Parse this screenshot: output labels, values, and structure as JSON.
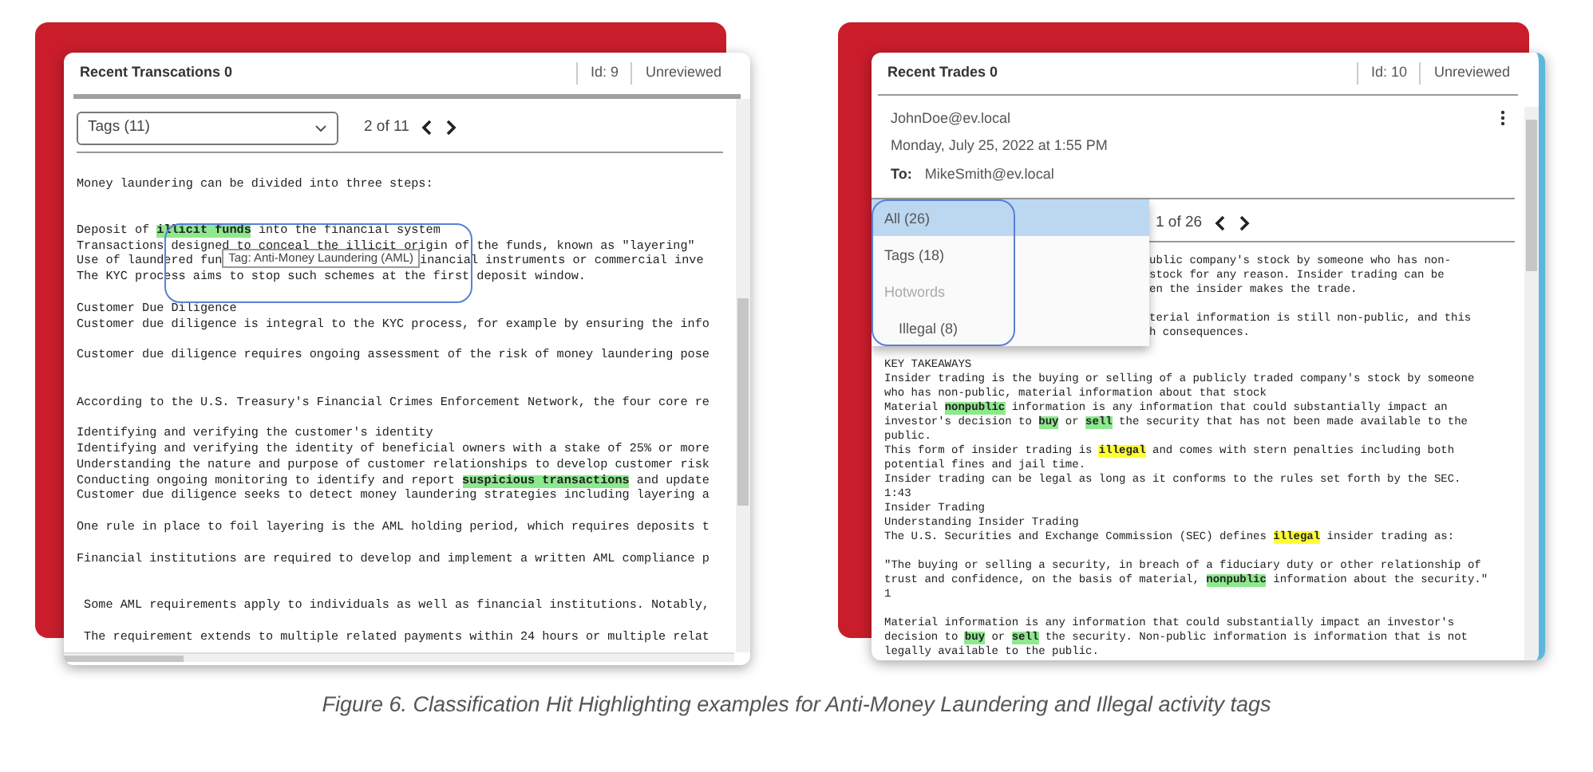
{
  "transaction_panel": {
    "title": "Recent Transcations 0",
    "id": "Id: 9",
    "status": "Unreviewed",
    "tag_select": {
      "value": "Tags (11)"
    },
    "pager": {
      "position": "2 of 11"
    },
    "lines": [
      {
        "kind": "text",
        "text": "Money laundering can be divided into three steps:"
      },
      {
        "kind": "blank"
      },
      {
        "kind": "blank"
      },
      {
        "kind": "marked",
        "segments": [
          {
            "kind": "plain",
            "text": "Deposit of "
          },
          {
            "kind": "hit",
            "text": "illicit funds",
            "color": "#8ee88e"
          },
          {
            "kind": "plain",
            "text": " into the financial system"
          }
        ]
      },
      {
        "kind": "text",
        "text": "Transactions designed to conceal the illicit origin of the funds, known as \"layering\""
      },
      {
        "kind": "marked",
        "segments": [
          {
            "kind": "plain",
            "text": "Use of laundered fun"
          },
          {
            "kind": "tooltip",
            "text": "Tag: Anti-Money Laundering (AML)"
          },
          {
            "kind": "plain",
            "text": "inancial instruments or commercial inve"
          }
        ]
      },
      {
        "kind": "text",
        "text": "The KYC process aims to stop such schemes at the first deposit window."
      },
      {
        "kind": "blank"
      },
      {
        "kind": "text",
        "text": "Customer Due Diligence"
      },
      {
        "kind": "text",
        "text": "Customer due diligence is integral to the KYC process, for example by ensuring the info"
      },
      {
        "kind": "blank"
      },
      {
        "kind": "text",
        "text": "Customer due diligence requires ongoing assessment of the risk of money laundering pose"
      },
      {
        "kind": "blank"
      },
      {
        "kind": "blank"
      },
      {
        "kind": "text",
        "text": "According to the U.S. Treasury's Financial Crimes Enforcement Network, the four core re"
      },
      {
        "kind": "blank"
      },
      {
        "kind": "text",
        "text": "Identifying and verifying the customer's identity"
      },
      {
        "kind": "text",
        "text": "Identifying and verifying the identity of beneficial owners with a stake of 25% or more"
      },
      {
        "kind": "text",
        "text": "Understanding the nature and purpose of customer relationships to develop customer risk"
      },
      {
        "kind": "marked",
        "segments": [
          {
            "kind": "plain",
            "text": "Conducting ongoing monitoring to identify and report "
          },
          {
            "kind": "hit",
            "text": "suspicious transactions",
            "color": "#8ee88e"
          },
          {
            "kind": "plain",
            "text": " and update"
          }
        ]
      },
      {
        "kind": "text",
        "text": "Customer due diligence seeks to detect money laundering strategies including layering a"
      },
      {
        "kind": "blank"
      },
      {
        "kind": "text",
        "text": "One rule in place to foil layering is the AML holding period, which requires deposits t"
      },
      {
        "kind": "blank"
      },
      {
        "kind": "text",
        "text": "Financial institutions are required to develop and implement a written AML compliance p"
      },
      {
        "kind": "blank"
      },
      {
        "kind": "blank"
      },
      {
        "kind": "text",
        "text": " Some AML requirements apply to individuals as well as financial institutions. Notably,"
      },
      {
        "kind": "blank"
      },
      {
        "kind": "text",
        "text": " The requirement extends to multiple related payments within 24 hours or multiple relat"
      }
    ]
  },
  "trade_panel": {
    "title": "Recent Trades 0",
    "id": "Id: 10",
    "status": "Unreviewed",
    "sender": "JohnDoe@ev.local",
    "date": "Monday, July 25, 2022 at 1:55 PM",
    "to_label": "To:",
    "recipient": "MikeSmith@ev.local",
    "filter_menu": {
      "options": [
        {
          "kind": "option",
          "label": "All (26)",
          "selected": true
        },
        {
          "kind": "option",
          "label": "Tags (18)",
          "selected": false
        },
        {
          "kind": "group",
          "label": "Hotwords",
          "children": [
            {
              "kind": "option",
              "label": "Illegal (8)",
              "selected": false
            }
          ]
        }
      ]
    },
    "pager": {
      "position": "1 of 26"
    },
    "partial_lines": [
      {
        "kind": "text",
        "text": "ublic company's stock by someone who has non-"
      },
      {
        "kind": "text",
        "text": "stock for any reason. Insider trading can be"
      },
      {
        "kind": "text",
        "text": "en the insider makes the trade."
      },
      {
        "kind": "blank"
      },
      {
        "kind": "text",
        "text": "terial information is still non-public, and this"
      },
      {
        "kind": "text",
        "text": "h consequences."
      }
    ],
    "lines": [
      {
        "kind": "text",
        "text": "KEY TAKEAWAYS"
      },
      {
        "kind": "text",
        "text": "Insider trading is the buying or selling of a publicly traded company's stock by someone"
      },
      {
        "kind": "text",
        "text": "who has non-public, material information about that stock"
      },
      {
        "kind": "marked",
        "segments": [
          {
            "kind": "plain",
            "text": "Material "
          },
          {
            "kind": "hit",
            "text": "nonpublic",
            "color": "#8ee88e"
          },
          {
            "kind": "plain",
            "text": " information is any information that could substantially impact an"
          }
        ]
      },
      {
        "kind": "marked",
        "segments": [
          {
            "kind": "plain",
            "text": "investor's decision to "
          },
          {
            "kind": "hit",
            "text": "buy",
            "color": "#8ee88e"
          },
          {
            "kind": "plain",
            "text": " or "
          },
          {
            "kind": "hit",
            "text": "sell",
            "color": "#8ee88e"
          },
          {
            "kind": "plain",
            "text": " the security that has not been made available to the"
          }
        ]
      },
      {
        "kind": "text",
        "text": "public."
      },
      {
        "kind": "marked",
        "segments": [
          {
            "kind": "plain",
            "text": "This form of insider trading is "
          },
          {
            "kind": "hit",
            "text": "illegal",
            "color": "#ffff33"
          },
          {
            "kind": "plain",
            "text": " and comes with stern penalties including both"
          }
        ]
      },
      {
        "kind": "text",
        "text": "potential fines and jail time."
      },
      {
        "kind": "text",
        "text": "Insider trading can be legal as long as it conforms to the rules set forth by the SEC."
      },
      {
        "kind": "text",
        "text": "1:43"
      },
      {
        "kind": "text",
        "text": "Insider Trading"
      },
      {
        "kind": "text",
        "text": "Understanding Insider Trading"
      },
      {
        "kind": "marked",
        "segments": [
          {
            "kind": "plain",
            "text": "The U.S. Securities and Exchange Commission (SEC) defines "
          },
          {
            "kind": "hit",
            "text": "illegal",
            "color": "#ffff33"
          },
          {
            "kind": "plain",
            "text": " insider trading as:"
          }
        ]
      },
      {
        "kind": "blank"
      },
      {
        "kind": "text",
        "text": "\"The buying or selling a security, in breach of a fiduciary duty or other relationship of"
      },
      {
        "kind": "marked",
        "segments": [
          {
            "kind": "plain",
            "text": "trust and confidence, on the basis of material, "
          },
          {
            "kind": "hit",
            "text": "nonpublic",
            "color": "#8ee88e"
          },
          {
            "kind": "plain",
            "text": " information about the security.\""
          }
        ]
      },
      {
        "kind": "text",
        "text": "1"
      },
      {
        "kind": "blank"
      },
      {
        "kind": "text",
        "text": "Material information is any information that could substantially impact an investor's"
      },
      {
        "kind": "marked",
        "segments": [
          {
            "kind": "plain",
            "text": "decision to "
          },
          {
            "kind": "hit",
            "text": "buy",
            "color": "#8ee88e"
          },
          {
            "kind": "plain",
            "text": " or "
          },
          {
            "kind": "hit",
            "text": "sell",
            "color": "#8ee88e"
          },
          {
            "kind": "plain",
            "text": " the security. Non-public information is information that is not"
          }
        ]
      },
      {
        "kind": "text",
        "text": "legally available to the public."
      }
    ]
  },
  "caption": "Figure 6. Classification Hit Highlighting examples for Anti-Money Laundering and Illegal activity tags"
}
